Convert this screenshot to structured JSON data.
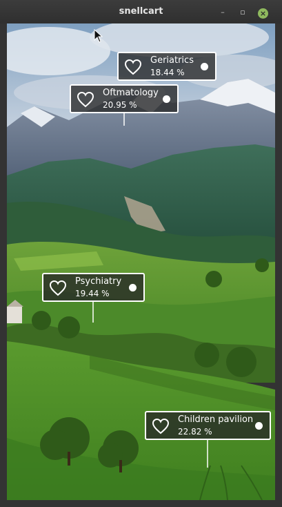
{
  "window": {
    "title": "snellcart",
    "controls": {
      "minimize": "–",
      "maximize": "▫",
      "close": "×"
    }
  },
  "markers": [
    {
      "name": "Geriatrics",
      "percent": "18.44 %",
      "icon": "heart-outline-icon"
    },
    {
      "name": "Oftmatology",
      "percent": "20.95 %",
      "icon": "heart-outline-icon"
    },
    {
      "name": "Psychiatry",
      "percent": "19.44 %",
      "icon": "heart-outline-icon"
    },
    {
      "name": "Children pavilion",
      "percent": "22.82 %",
      "icon": "heart-outline-icon"
    }
  ],
  "colors": {
    "titlebar": "#333333",
    "close_button": "#8fb95e",
    "marker_background": "#282828",
    "marker_border": "#ffffff"
  }
}
